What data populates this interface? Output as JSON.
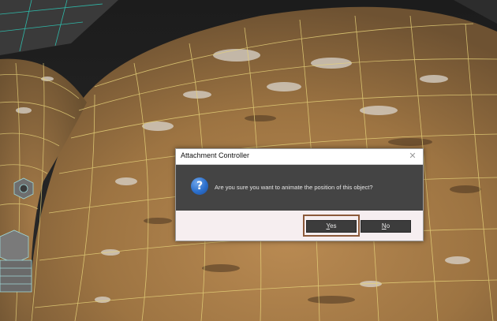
{
  "dialog": {
    "title": "Attachment Controller",
    "close_glyph": "✕",
    "icon": "question-icon",
    "icon_glyph": "?",
    "message": "Are you sure you want to animate the position of this object?",
    "yes_accel": "Y",
    "yes_rest": "es",
    "no_accel": "N",
    "no_rest": "o"
  },
  "colors": {
    "dialog_body": "#444444",
    "footer": "#f6eef0",
    "button": "#3c3c3c",
    "focus_outline": "#8c5a3a",
    "wireframe": "#e6d27a"
  }
}
